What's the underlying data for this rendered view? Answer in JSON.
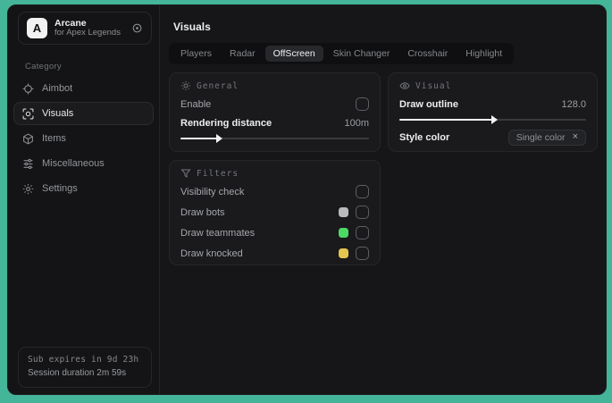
{
  "app": {
    "logo_letter": "A",
    "name": "Arcane",
    "subtitle": "for Apex Legends"
  },
  "sidebar": {
    "category_label": "Category",
    "items": [
      {
        "label": "Aimbot",
        "icon": "crosshair-icon",
        "selected": false
      },
      {
        "label": "Visuals",
        "icon": "eye-scan-icon",
        "selected": true
      },
      {
        "label": "Items",
        "icon": "cube-icon",
        "selected": false
      },
      {
        "label": "Miscellaneous",
        "icon": "sliders-icon",
        "selected": false
      },
      {
        "label": "Settings",
        "icon": "gear-icon",
        "selected": false
      }
    ],
    "footer": {
      "sub_expires": "Sub expires in 9d 23h",
      "session_duration": "Session duration 2m 59s"
    }
  },
  "main": {
    "title": "Visuals",
    "tabs": [
      {
        "label": "Players",
        "selected": false
      },
      {
        "label": "Radar",
        "selected": false
      },
      {
        "label": "OffScreen",
        "selected": true
      },
      {
        "label": "Skin Changer",
        "selected": false
      },
      {
        "label": "Crosshair",
        "selected": false
      },
      {
        "label": "Highlight",
        "selected": false
      }
    ],
    "general": {
      "title": "General",
      "icon": "sun-icon",
      "enable_label": "Enable",
      "enable_checked": false,
      "rendering_label": "Rendering distance",
      "rendering_value": "100m",
      "rendering_fill": "20%"
    },
    "visual": {
      "title": "Visual",
      "icon": "eye-icon",
      "outline_label": "Draw outline",
      "outline_value": "128.0",
      "outline_fill": "50%",
      "style_label": "Style color",
      "style_tag": "Single color",
      "style_tag_close": "×"
    },
    "filters": {
      "title": "Filters",
      "icon": "funnel-icon",
      "rows": [
        {
          "label": "Visibility check",
          "swatch": "",
          "checked": false
        },
        {
          "label": "Draw bots",
          "swatch": "#b9babc",
          "checked": false
        },
        {
          "label": "Draw teammates",
          "swatch": "#4cd964",
          "checked": false
        },
        {
          "label": "Draw knocked",
          "swatch": "#e3c64f",
          "checked": false
        }
      ]
    }
  },
  "colors": {
    "desktop_accent": "#44b598",
    "window_bg": "#151517",
    "card_bg": "#1a1a1d",
    "selected_tab_bg": "#27282b",
    "bot_swatch": "#b9babc",
    "teammate_swatch": "#4cd964",
    "knocked_swatch": "#e3c64f"
  }
}
